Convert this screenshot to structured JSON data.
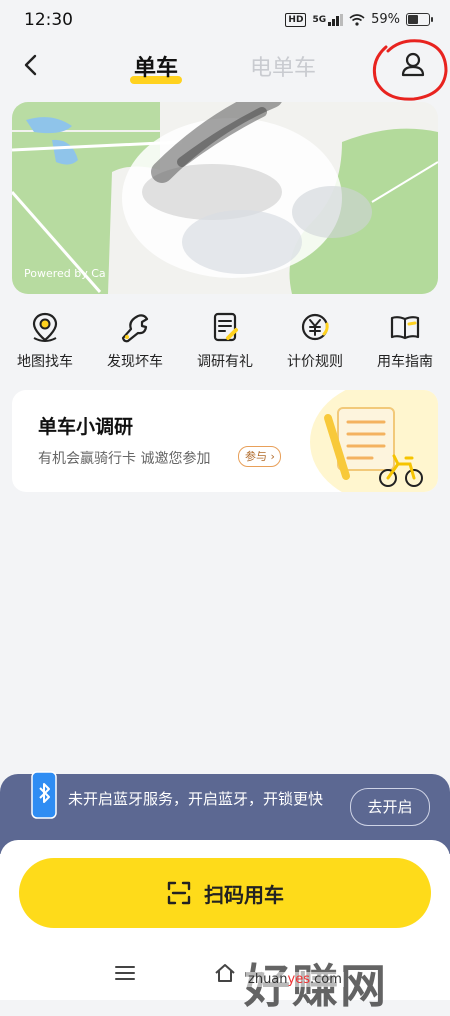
{
  "status_bar": {
    "time": "12:30",
    "network": "5G",
    "battery": "59%",
    "battery_level": 0.59
  },
  "nav": {
    "tab_bike": "单车",
    "tab_ebike": "电单车"
  },
  "map": {
    "credit": "Powered by Ca"
  },
  "quick_actions": [
    {
      "label": "地图找车",
      "icon": "map-pin-icon"
    },
    {
      "label": "发现坏车",
      "icon": "wrench-icon"
    },
    {
      "label": "调研有礼",
      "icon": "survey-icon"
    },
    {
      "label": "计价规则",
      "icon": "yuan-icon"
    },
    {
      "label": "用车指南",
      "icon": "book-icon"
    }
  ],
  "survey": {
    "title": "单车小调研",
    "subtitle": "有机会赢骑行卡 诚邀您参加",
    "join": "参与"
  },
  "bluetooth_banner": {
    "text": "未开启蓝牙服务，开启蓝牙，开锁更快",
    "button": "去开启"
  },
  "scan": {
    "label": "扫码用车"
  },
  "watermark": {
    "main": "好赚网",
    "url_part1": "zhuan",
    "url_part2": "yes",
    "url_part3": ".com"
  },
  "colors": {
    "accent_yellow": "#fedb1a",
    "banner_blue": "#5c6892",
    "annotation_red": "#e8231f"
  }
}
